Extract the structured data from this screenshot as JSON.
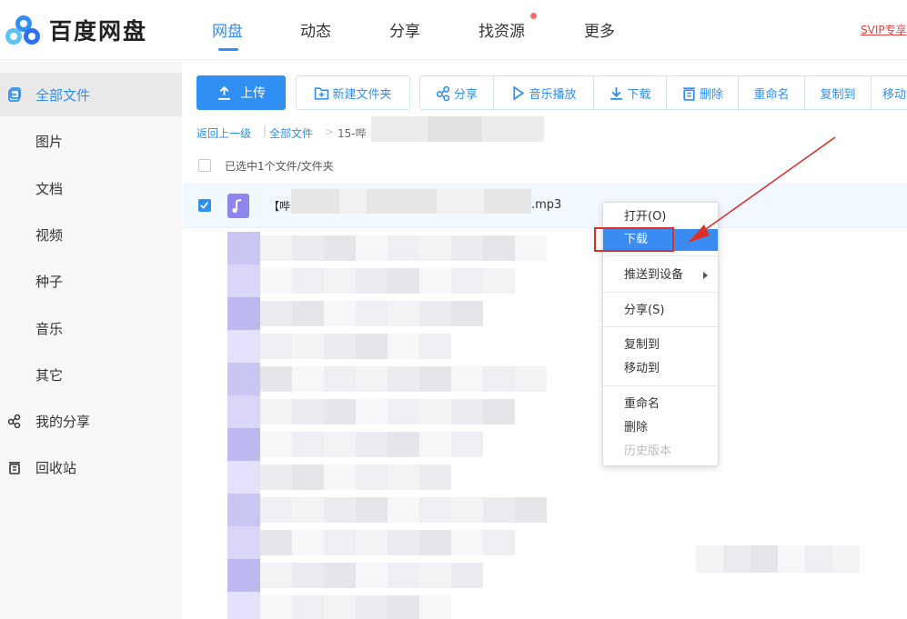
{
  "header": {
    "brand": "百度网盘",
    "nav": [
      "网盘",
      "动态",
      "分享",
      "找资源",
      "更多"
    ],
    "svip": "SVIP专享"
  },
  "sidebar": {
    "items": [
      {
        "label": "全部文件",
        "icon": "files-icon"
      },
      {
        "label": "图片"
      },
      {
        "label": "文档"
      },
      {
        "label": "视频"
      },
      {
        "label": "种子"
      },
      {
        "label": "音乐"
      },
      {
        "label": "其它"
      },
      {
        "label": "我的分享",
        "icon": "share-icon"
      },
      {
        "label": "回收站",
        "icon": "trash-icon"
      }
    ]
  },
  "toolbar": {
    "upload": "上传",
    "new_folder": "新建文件夹",
    "share": "分享",
    "music_play": "音乐播放",
    "download": "下载",
    "delete": "删除",
    "rename": "重命名",
    "copy_to": "复制到",
    "move_to": "移动"
  },
  "breadcrumb": {
    "back": "返回上一级",
    "all_files": "全部文件",
    "sep": ">",
    "current": "15-哔"
  },
  "selection": {
    "text": "已选中1个文件/文件夹"
  },
  "file": {
    "name_prefix": "【哔",
    "extension": ".mp3"
  },
  "context_menu": {
    "open": "打开(O)",
    "download": "下载",
    "push_to_device": "推送到设备",
    "share": "分享(S)",
    "copy_to": "复制到",
    "move_to": "移动到",
    "rename": "重命名",
    "delete": "删除",
    "history": "历史版本"
  },
  "colors": {
    "accent": "#2f8ff2",
    "annotation": "#d9312a",
    "menu_highlight": "#3b8cf2"
  }
}
